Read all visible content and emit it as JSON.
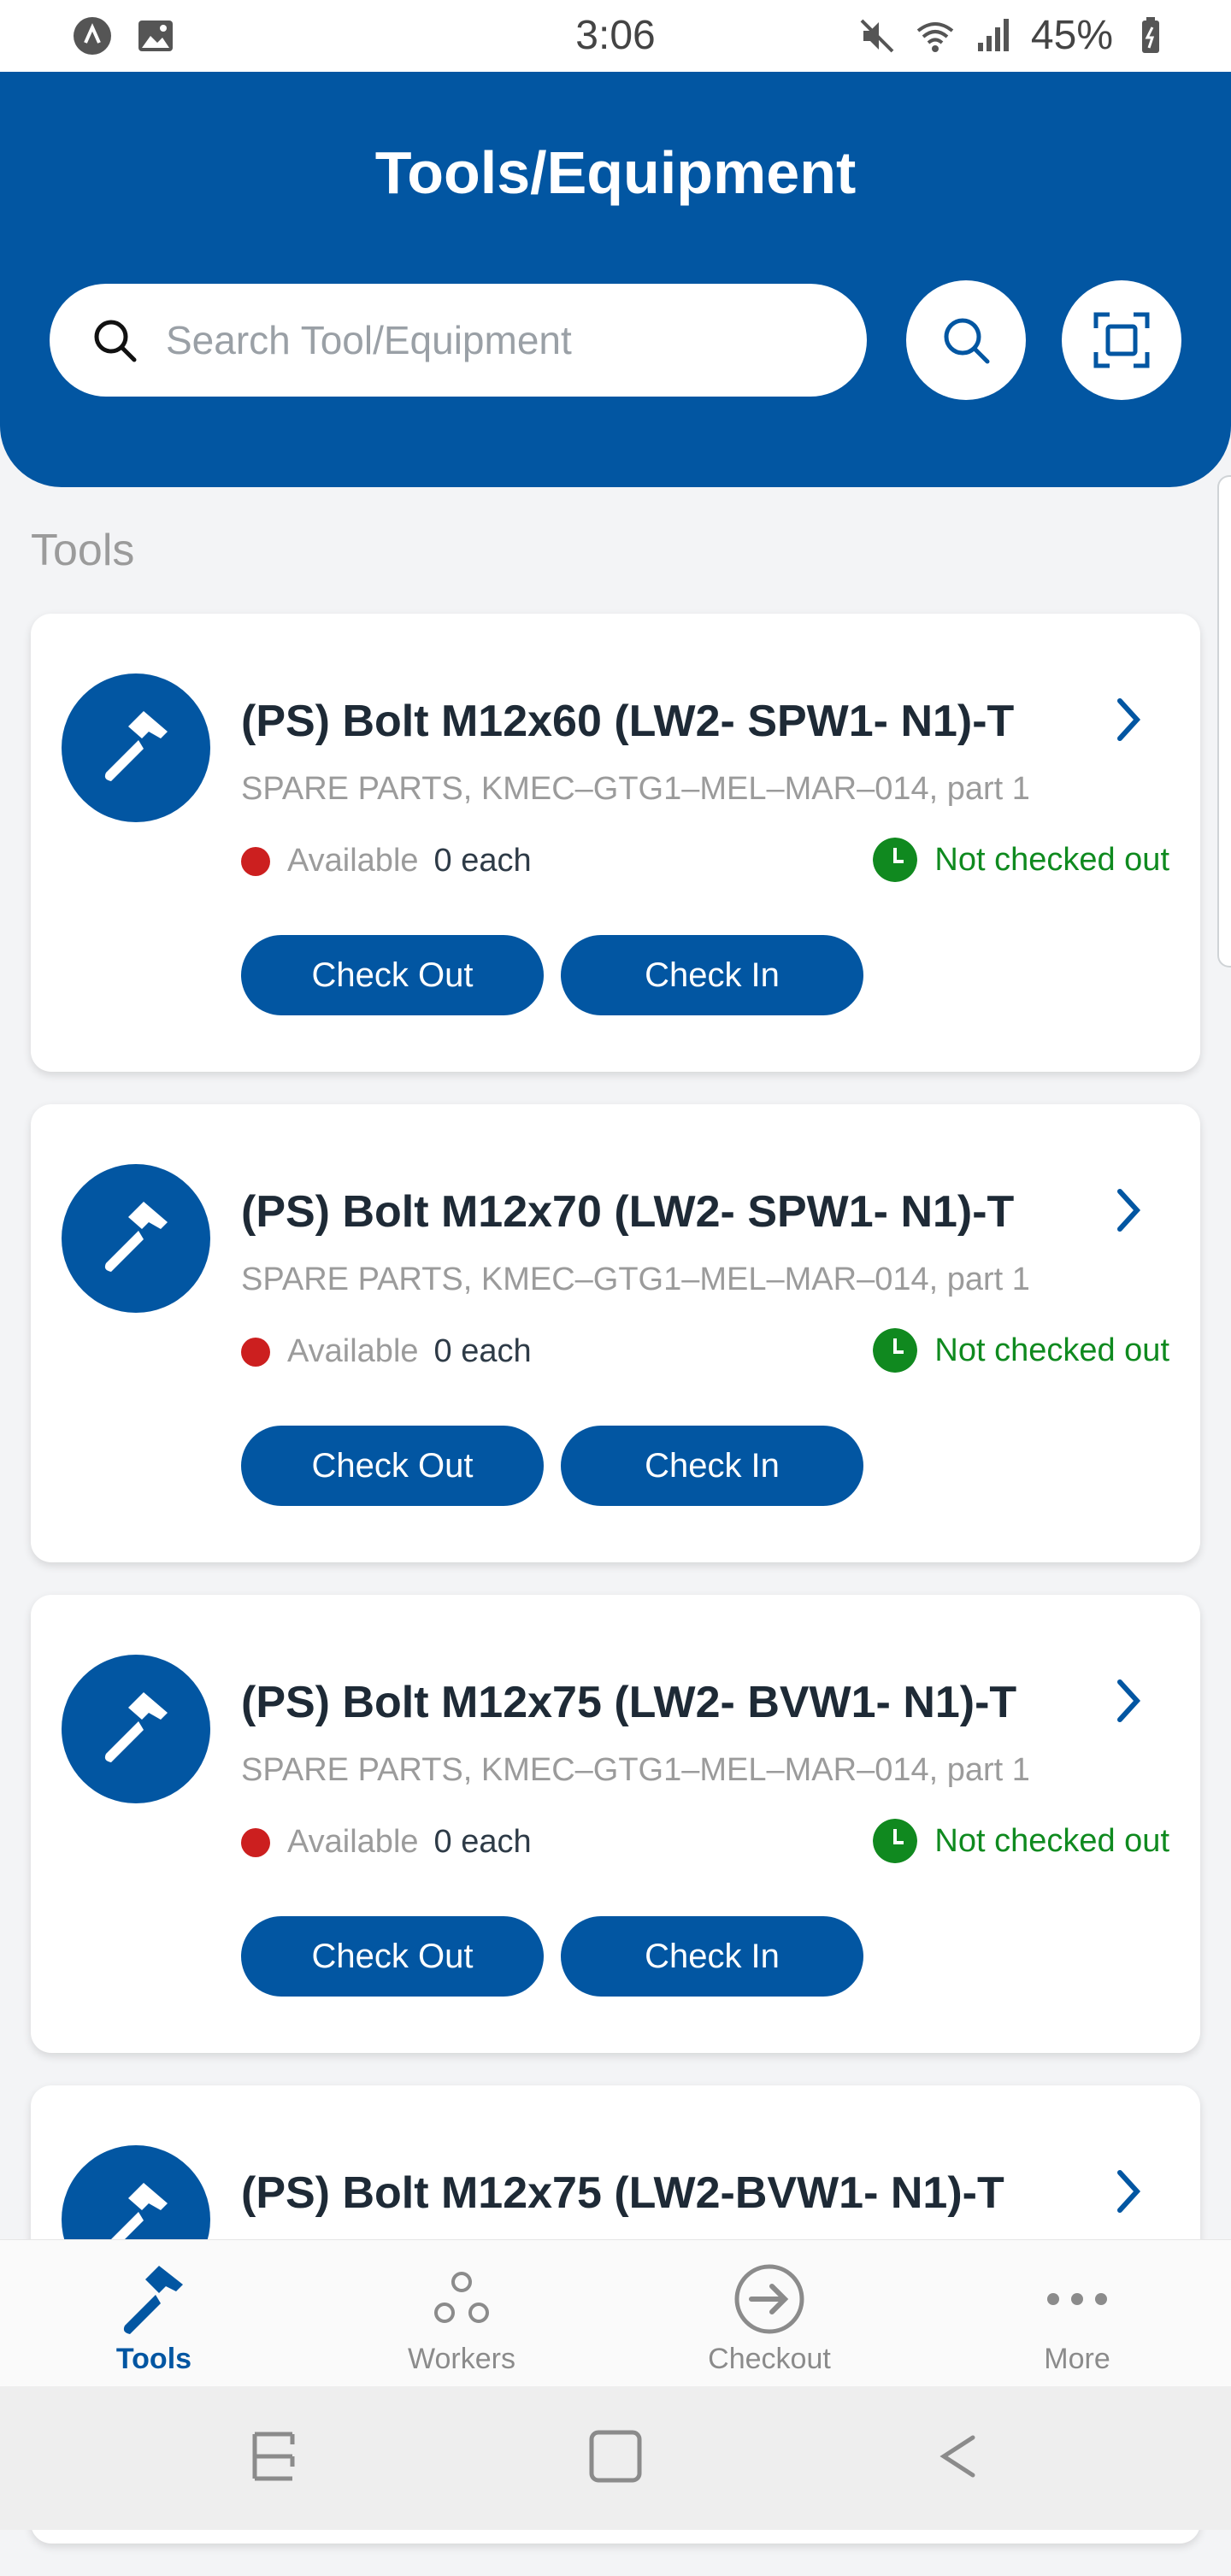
{
  "status_bar": {
    "time": "3:06",
    "battery": "45%"
  },
  "header": {
    "title": "Tools/Equipment",
    "search_placeholder": "Search Tool/Equipment"
  },
  "section": {
    "title": "Tools"
  },
  "items": [
    {
      "name": "(PS) Bolt M12x60 (LW2- SPW1- N1)-T",
      "subtitle": "SPARE PARTS, KMEC–GTG1–MEL–MAR–014, part 1",
      "available_label": "Available",
      "available_value": "0 each",
      "status": "Not checked out",
      "check_out": "Check Out",
      "check_in": "Check In"
    },
    {
      "name": "(PS) Bolt M12x70 (LW2- SPW1- N1)-T",
      "subtitle": "SPARE PARTS, KMEC–GTG1–MEL–MAR–014, part 1",
      "available_label": "Available",
      "available_value": "0 each",
      "status": "Not checked out",
      "check_out": "Check Out",
      "check_in": "Check In"
    },
    {
      "name": "(PS) Bolt M12x75 (LW2- BVW1- N1)-T",
      "subtitle": "SPARE PARTS, KMEC–GTG1–MEL–MAR–014, part 1",
      "available_label": "Available",
      "available_value": "0 each",
      "status": "Not checked out",
      "check_out": "Check Out",
      "check_in": "Check In"
    },
    {
      "name": "(PS) Bolt M12x75 (LW2-BVW1- N1)-T"
    }
  ],
  "bottom_nav": [
    {
      "label": "Tools",
      "icon": "hammer-icon",
      "active": true
    },
    {
      "label": "Workers",
      "icon": "workers-icon",
      "active": false
    },
    {
      "label": "Checkout",
      "icon": "checkout-icon",
      "active": false
    },
    {
      "label": "More",
      "icon": "more-icon",
      "active": false
    }
  ],
  "colors": {
    "brand": "#0256a2",
    "available_dot": "#cc1f1f",
    "status_green": "#0f8a1f"
  }
}
